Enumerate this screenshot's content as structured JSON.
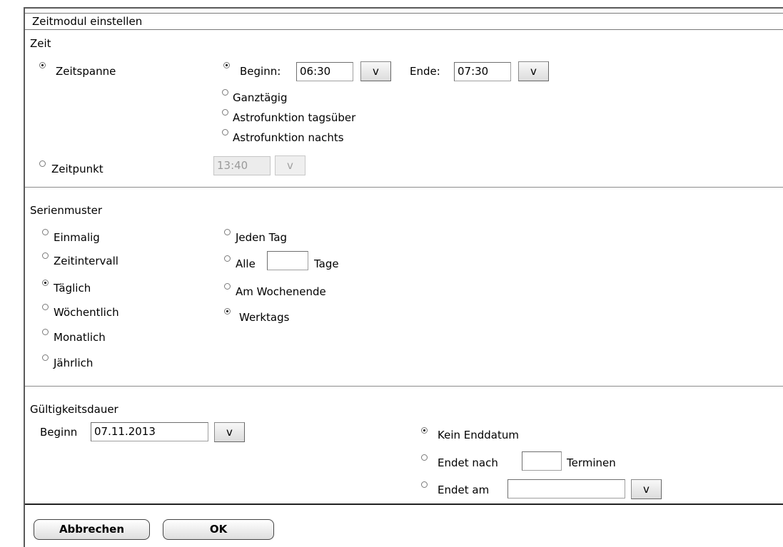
{
  "dialog": {
    "title": "Zeitmodul einstellen"
  },
  "zeit": {
    "heading": "Zeit",
    "zeitspanne_label": "Zeitspanne",
    "beginn_label": "Beginn:",
    "beginn_value": "06:30",
    "ende_label": "Ende:",
    "ende_value": "07:30",
    "picker_label": "v",
    "ganztaegig_label": "Ganztägig",
    "astro_tag_label": "Astrofunktion tagsüber",
    "astro_nacht_label": "Astrofunktion nachts",
    "zeitpunkt_label": "Zeitpunkt",
    "zeitpunkt_value": "13:40"
  },
  "serie": {
    "heading": "Serienmuster",
    "einmalig": "Einmalig",
    "zeitintervall": "Zeitintervall",
    "taeglich": "Täglich",
    "woechentlich": "Wöchentlich",
    "monatlich": "Monatlich",
    "jaehrlich": "Jährlich",
    "jeden_tag": "Jeden Tag",
    "alle": "Alle",
    "alle_value": "",
    "tage": "Tage",
    "wochenende": "Am Wochenende",
    "werktags": "Werktags"
  },
  "gueltigkeit": {
    "heading": "Gültigkeitsdauer",
    "beginn_label": "Beginn",
    "beginn_value": "07.11.2013",
    "kein_enddatum": "Kein Enddatum",
    "endet_nach": "Endet nach",
    "endet_nach_value": "",
    "terminen": "Terminen",
    "endet_am": "Endet am",
    "endet_am_value": ""
  },
  "buttons": {
    "cancel": "Abbrechen",
    "ok": "OK"
  }
}
